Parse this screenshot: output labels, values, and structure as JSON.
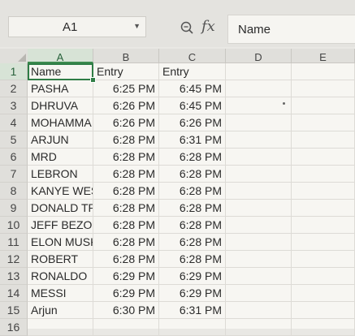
{
  "formula_bar": {
    "name_box": "A1",
    "formula_value": "Name"
  },
  "columns": [
    "A",
    "B",
    "C",
    "D",
    "E"
  ],
  "rows": [
    {
      "num": "1",
      "a": "Name",
      "b": "Entry",
      "c": "Entry"
    },
    {
      "num": "2",
      "a": "PASHA",
      "b": "6:25 PM",
      "c": "6:45 PM"
    },
    {
      "num": "3",
      "a": "DHRUVA",
      "b": "6:26 PM",
      "c": "6:45 PM"
    },
    {
      "num": "4",
      "a": "MOHAMMA",
      "b": "6:26 PM",
      "c": "6:26 PM"
    },
    {
      "num": "5",
      "a": "ARJUN",
      "b": "6:28 PM",
      "c": "6:31 PM"
    },
    {
      "num": "6",
      "a": "MRD",
      "b": "6:28 PM",
      "c": "6:28 PM"
    },
    {
      "num": "7",
      "a": "LEBRON",
      "b": "6:28 PM",
      "c": "6:28 PM"
    },
    {
      "num": "8",
      "a": "KANYE WES",
      "b": "6:28 PM",
      "c": "6:28 PM"
    },
    {
      "num": "9",
      "a": "DONALD TR",
      "b": "6:28 PM",
      "c": "6:28 PM"
    },
    {
      "num": "10",
      "a": "JEFF BEZOS",
      "b": "6:28 PM",
      "c": "6:28 PM"
    },
    {
      "num": "11",
      "a": "ELON MUSK",
      "b": "6:28 PM",
      "c": "6:28 PM"
    },
    {
      "num": "12",
      "a": "ROBERT",
      "b": "6:28 PM",
      "c": "6:28 PM"
    },
    {
      "num": "13",
      "a": "RONALDO",
      "b": "6:29 PM",
      "c": "6:29 PM"
    },
    {
      "num": "14",
      "a": "MESSI",
      "b": "6:29 PM",
      "c": "6:29 PM"
    },
    {
      "num": "15",
      "a": "Arjun",
      "b": "6:30 PM",
      "c": "6:31 PM"
    },
    {
      "num": "16",
      "a": "",
      "b": "",
      "c": ""
    }
  ],
  "icons": {
    "zoom": "zoom-icon",
    "function": "fx-icon",
    "dropdown": "chevron-down-icon"
  },
  "colors": {
    "selection": "#2f7d46",
    "header_bg": "#e0dfdb",
    "cell_bg": "#f7f6f2"
  }
}
